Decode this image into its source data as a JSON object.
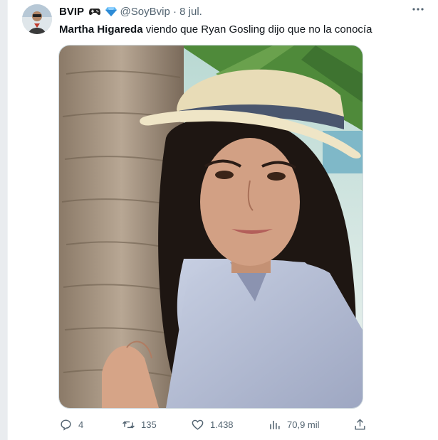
{
  "tweet": {
    "author_name": "BVIP",
    "author_badges_text": "🎮💎",
    "handle": "@SoyBvip",
    "separator": "·",
    "date": "8 jul.",
    "text_bold": "Martha Higareda",
    "text_rest": " viendo que Ryan Gosling dijo que no la conocía"
  },
  "actions": {
    "replies": "4",
    "retweets": "135",
    "likes": "1.438",
    "views": "70,9 mil"
  },
  "icons": [
    "more-icon",
    "reply-icon",
    "retweet-icon",
    "like-icon",
    "views-icon",
    "share-icon",
    "gamepad-icon",
    "gem-icon"
  ],
  "colors": {
    "text": "#0f1419",
    "muted": "#536471",
    "border": "#cfd9de",
    "background": "#ffffff"
  }
}
